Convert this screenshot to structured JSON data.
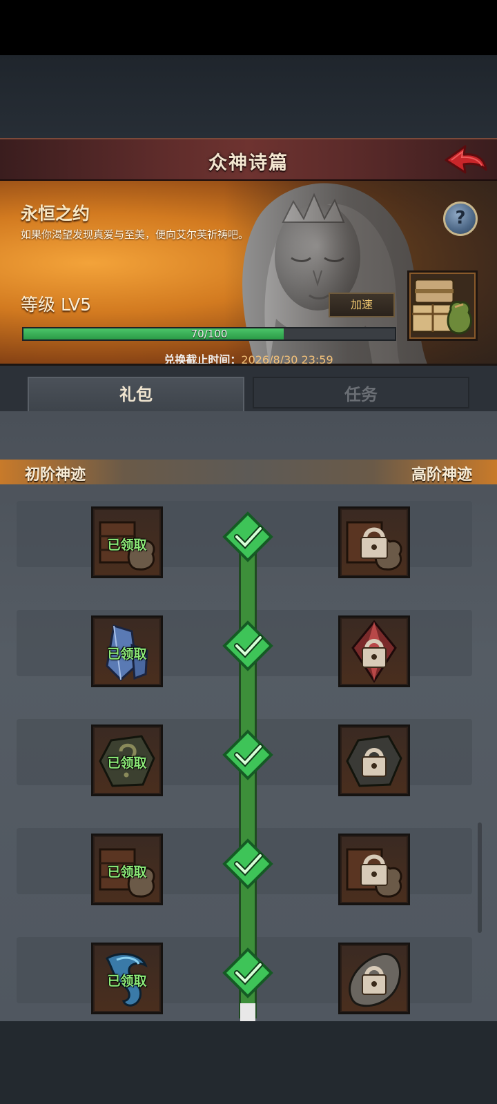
{
  "header": {
    "title": "众神诗篇",
    "back_icon": "back-arrow-icon"
  },
  "banner": {
    "title": "永恒之约",
    "description": "如果你渴望发现真爱与至美，便向艾尔芙祈祷吧。",
    "level_label": "等级 LV5",
    "speed_button": "加速",
    "help_label": "?",
    "progress": {
      "text": "70/100",
      "current": 70,
      "max": 100
    },
    "deadline_label": "兑换截止时间：",
    "deadline_value": "2026/8/30 23:59",
    "accent_color": "#d27a20"
  },
  "tabs": [
    {
      "label": "礼包",
      "active": true
    },
    {
      "label": "任务",
      "active": false
    }
  ],
  "tier": {
    "left_label": "初阶神迹",
    "right_label": "高阶神迹"
  },
  "rewards": [
    {
      "basic_icon": "crate-sack-icon",
      "basic_status": "已领取",
      "premium_icon": "locked-crate-sack-icon",
      "completed": true
    },
    {
      "basic_icon": "crystal-icon",
      "basic_status": "已领取",
      "premium_icon": "locked-red-crystal-icon",
      "completed": true
    },
    {
      "basic_icon": "mystery-stone-icon",
      "basic_status": "已领取",
      "premium_icon": "locked-ore-icon",
      "completed": true
    },
    {
      "basic_icon": "crate-sack-icon",
      "basic_status": "已领取",
      "premium_icon": "locked-crate-sack-icon",
      "completed": true
    },
    {
      "basic_icon": "blue-flame-icon",
      "basic_status": "已领取",
      "premium_icon": "locked-rock-icon",
      "completed": true
    }
  ],
  "colors": {
    "track_green": "#3d8f3a",
    "claimed_text": "#8dea78",
    "tier_orange": "#c87a2a"
  }
}
